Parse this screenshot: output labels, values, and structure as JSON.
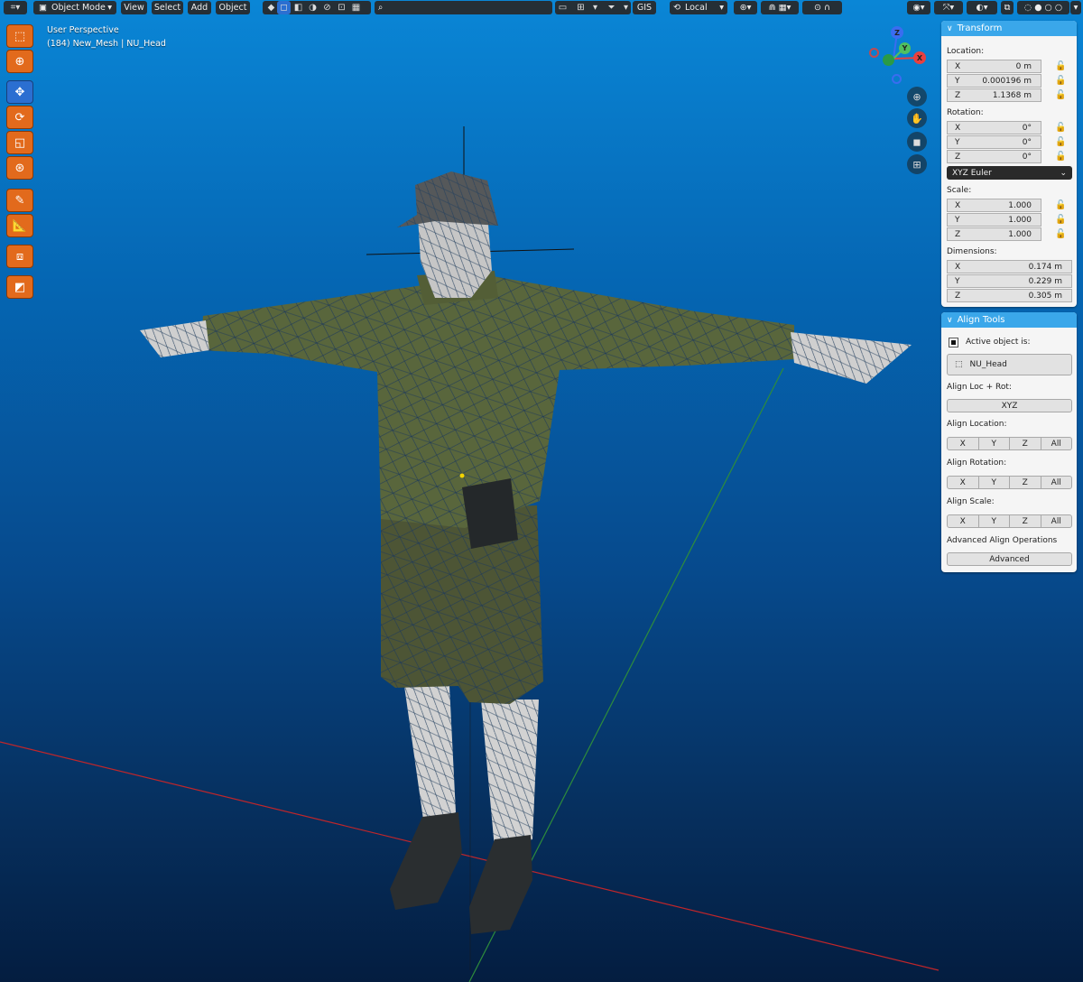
{
  "header": {
    "mode": "Object Mode",
    "menus": [
      "View",
      "Select",
      "Add",
      "Object"
    ],
    "gis": "GIS",
    "orientation": "Local"
  },
  "viewport": {
    "perspective": "User Perspective",
    "object_info": "(184) New_Mesh | NU_Head"
  },
  "gizmo": {
    "z": "Z",
    "y": "Y",
    "x": "X"
  },
  "toolbar": {
    "tools": [
      "select-box-icon",
      "cursor-icon",
      "move-icon",
      "rotate-icon",
      "scale-icon",
      "transform-icon",
      "annotate-icon",
      "measure-icon",
      "add-cube-icon",
      "extra-tool-icon"
    ]
  },
  "transform": {
    "title": "Transform",
    "location_label": "Location:",
    "location": [
      {
        "axis": "X",
        "value": "0 m"
      },
      {
        "axis": "Y",
        "value": "0.000196 m"
      },
      {
        "axis": "Z",
        "value": "1.1368 m"
      }
    ],
    "rotation_label": "Rotation:",
    "rotation": [
      {
        "axis": "X",
        "value": "0°"
      },
      {
        "axis": "Y",
        "value": "0°"
      },
      {
        "axis": "Z",
        "value": "0°"
      }
    ],
    "rotation_mode": "XYZ Euler",
    "scale_label": "Scale:",
    "scale": [
      {
        "axis": "X",
        "value": "1.000"
      },
      {
        "axis": "Y",
        "value": "1.000"
      },
      {
        "axis": "Z",
        "value": "1.000"
      }
    ],
    "dimensions_label": "Dimensions:",
    "dimensions": [
      {
        "axis": "X",
        "value": "0.174 m"
      },
      {
        "axis": "Y",
        "value": "0.229 m"
      },
      {
        "axis": "Z",
        "value": "0.305 m"
      }
    ]
  },
  "align_tools": {
    "title": "Align Tools",
    "active_label": "Active object is:",
    "active_object": "NU_Head",
    "loc_rot_label": "Align Loc + Rot:",
    "xyz_button": "XYZ",
    "location_label": "Align Location:",
    "rotation_label": "Align Rotation:",
    "scale_label": "Align Scale:",
    "axes": [
      "X",
      "Y",
      "Z",
      "All"
    ],
    "advanced_label": "Advanced Align Operations",
    "advanced_button": "Advanced"
  }
}
